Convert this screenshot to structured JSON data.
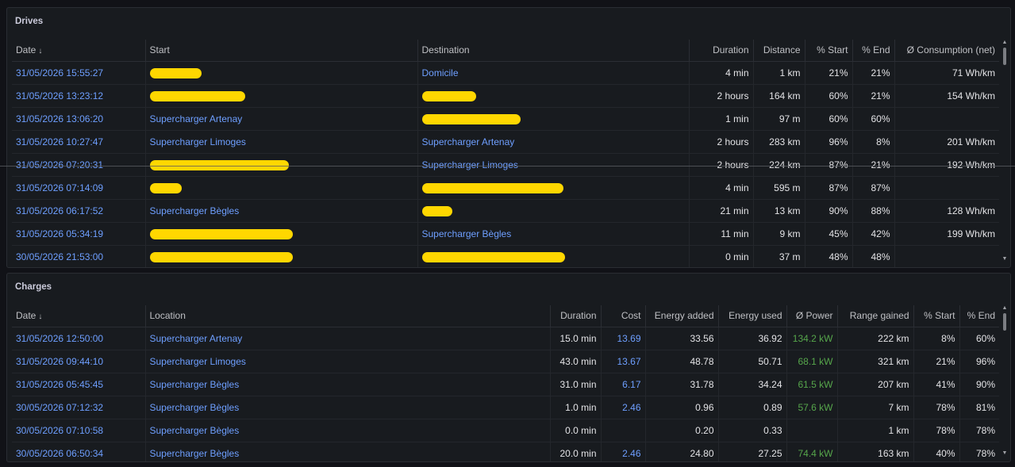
{
  "drives": {
    "title": "Drives",
    "columns": [
      "Date",
      "Start",
      "Destination",
      "Duration",
      "Distance",
      "% Start",
      "% End",
      "Ø Consumption (net)"
    ],
    "rows": [
      {
        "date": "31/05/2026 15:55:27",
        "start": "",
        "destination": "Domicile",
        "duration": "4 min",
        "distance": "1 km",
        "start_pct": "21%",
        "end_pct": "21%",
        "consumption": "71 Wh/km"
      },
      {
        "date": "31/05/2026 13:23:12",
        "start": "",
        "destination": "",
        "duration": "2 hours",
        "distance": "164 km",
        "start_pct": "60%",
        "end_pct": "21%",
        "consumption": "154 Wh/km"
      },
      {
        "date": "31/05/2026 13:06:20",
        "start": "Supercharger Artenay",
        "destination": "",
        "duration": "1 min",
        "distance": "97 m",
        "start_pct": "60%",
        "end_pct": "60%",
        "consumption": ""
      },
      {
        "date": "31/05/2026 10:27:47",
        "start": "Supercharger Limoges",
        "destination": "Supercharger Artenay",
        "duration": "2 hours",
        "distance": "283 km",
        "start_pct": "96%",
        "end_pct": "8%",
        "consumption": "201 Wh/km"
      },
      {
        "date": "31/05/2026 07:20:31",
        "start": "",
        "destination": "Supercharger Limoges",
        "duration": "2 hours",
        "distance": "224 km",
        "start_pct": "87%",
        "end_pct": "21%",
        "consumption": "192 Wh/km"
      },
      {
        "date": "31/05/2026 07:14:09",
        "start": "",
        "destination": "",
        "duration": "4 min",
        "distance": "595 m",
        "start_pct": "87%",
        "end_pct": "87%",
        "consumption": ""
      },
      {
        "date": "31/05/2026 06:17:52",
        "start": "Supercharger Bègles",
        "destination": "",
        "duration": "21 min",
        "distance": "13 km",
        "start_pct": "90%",
        "end_pct": "88%",
        "consumption": "128 Wh/km"
      },
      {
        "date": "31/05/2026 05:34:19",
        "start": "",
        "destination": "Supercharger Bègles",
        "duration": "11 min",
        "distance": "9 km",
        "start_pct": "45%",
        "end_pct": "42%",
        "consumption": "199 Wh/km"
      },
      {
        "date": "30/05/2026 21:53:00",
        "start": "",
        "destination": "",
        "duration": "0 min",
        "distance": "37 m",
        "start_pct": "48%",
        "end_pct": "48%",
        "consumption": ""
      }
    ]
  },
  "charges": {
    "title": "Charges",
    "columns": [
      "Date",
      "Location",
      "Duration",
      "Cost",
      "Energy added",
      "Energy used",
      "Ø Power",
      "Range gained",
      "% Start",
      "% End"
    ],
    "rows": [
      {
        "date": "31/05/2026 12:50:00",
        "location": "Supercharger Artenay",
        "duration": "15.0 min",
        "cost": "13.69",
        "energy_added": "33.56",
        "energy_used": "36.92",
        "power": "134.2 kW",
        "range": "222 km",
        "start_pct": "8%",
        "end_pct": "60%"
      },
      {
        "date": "31/05/2026 09:44:10",
        "location": "Supercharger Limoges",
        "duration": "43.0 min",
        "cost": "13.67",
        "energy_added": "48.78",
        "energy_used": "50.71",
        "power": "68.1 kW",
        "range": "321 km",
        "start_pct": "21%",
        "end_pct": "96%"
      },
      {
        "date": "31/05/2026 05:45:45",
        "location": "Supercharger Bègles",
        "duration": "31.0 min",
        "cost": "6.17",
        "energy_added": "31.78",
        "energy_used": "34.24",
        "power": "61.5 kW",
        "range": "207 km",
        "start_pct": "41%",
        "end_pct": "90%"
      },
      {
        "date": "30/05/2026 07:12:32",
        "location": "Supercharger Bègles",
        "duration": "1.0 min",
        "cost": "2.46",
        "energy_added": "0.96",
        "energy_used": "0.89",
        "power": "57.6 kW",
        "range": "7 km",
        "start_pct": "78%",
        "end_pct": "81%"
      },
      {
        "date": "30/05/2026 07:10:58",
        "location": "Supercharger Bègles",
        "duration": "0.0 min",
        "cost": "",
        "energy_added": "0.20",
        "energy_used": "0.33",
        "power": "",
        "range": "1 km",
        "start_pct": "78%",
        "end_pct": "78%"
      },
      {
        "date": "30/05/2026 06:50:34",
        "location": "Supercharger Bègles",
        "duration": "20.0 min",
        "cost": "2.46",
        "energy_added": "24.80",
        "energy_used": "27.25",
        "power": "74.4 kW",
        "range": "163 km",
        "start_pct": "40%",
        "end_pct": "78%"
      }
    ]
  },
  "icons": {
    "sort": "arrow-down-icon",
    "scroll_up": "triangle-up-icon",
    "scroll_down": "triangle-down-icon"
  },
  "colors": {
    "link": "#6e9fff",
    "power": "#56a64b",
    "redaction": "#ffd700",
    "background": "#111217",
    "panel": "#181b1f"
  }
}
